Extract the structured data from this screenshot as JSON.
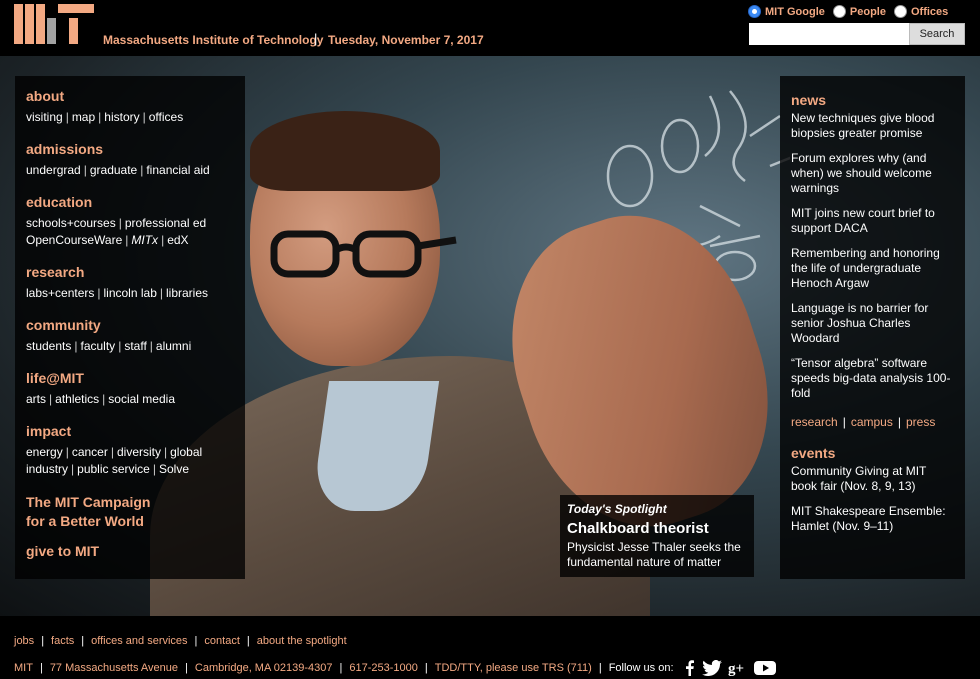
{
  "header": {
    "site_title": "Massachusetts Institute of Technology",
    "separator": "|",
    "date": "Tuesday, November 7, 2017",
    "search": {
      "options": [
        "MIT Google",
        "People",
        "Offices"
      ],
      "selected": "MIT Google",
      "button": "Search",
      "value": ""
    }
  },
  "leftnav": {
    "groups": [
      {
        "heading": "about",
        "lines": [
          [
            "visiting",
            "map",
            "history",
            "offices"
          ]
        ]
      },
      {
        "heading": "admissions",
        "lines": [
          [
            "undergrad",
            "graduate",
            "financial aid"
          ]
        ]
      },
      {
        "heading": "education",
        "lines": [
          [
            "schools+courses",
            "professional ed"
          ],
          [
            "OpenCourseWare",
            "MITx",
            "edX"
          ]
        ]
      },
      {
        "heading": "research",
        "lines": [
          [
            "labs+centers",
            "lincoln lab",
            "libraries"
          ]
        ]
      },
      {
        "heading": "community",
        "lines": [
          [
            "students",
            "faculty",
            "staff",
            "alumni"
          ]
        ]
      },
      {
        "heading": "life@MIT",
        "lines": [
          [
            "arts",
            "athletics",
            "social media"
          ]
        ]
      },
      {
        "heading": "impact",
        "lines": [
          [
            "energy",
            "cancer",
            "diversity",
            "global"
          ],
          [
            "industry",
            "public service",
            "Solve"
          ]
        ]
      }
    ],
    "campaign_line1": "The MIT Campaign",
    "campaign_line2": "for a Better World",
    "give": "give to MIT"
  },
  "spotlight": {
    "label": "Today's Spotlight",
    "title": "Chalkboard theorist",
    "description": "Physicist Jesse Thaler seeks the fundamental nature of matter"
  },
  "news": {
    "heading": "news",
    "items": [
      "New techniques give blood biopsies greater promise",
      "Forum explores why (and when) we should welcome warnings",
      "MIT joins new court brief to support DACA",
      "Remembering and honoring the life of undergraduate Henoch Argaw",
      "Language is no barrier for senior Joshua Charles Woodard",
      "“Tensor algebra” software speeds big-data analysis 100-fold"
    ],
    "links": [
      "research",
      "campus",
      "press"
    ]
  },
  "events": {
    "heading": "events",
    "items": [
      "Community Giving at MIT book fair (Nov. 8, 9, 13)",
      "MIT Shakespeare Ensemble: Hamlet (Nov. 9–11)"
    ]
  },
  "footer": {
    "row1": [
      "jobs",
      "facts",
      "offices and services",
      "contact",
      "about the spotlight"
    ],
    "row2": [
      "MIT",
      "77 Massachusetts Avenue",
      "Cambridge, MA 02139-4307",
      "617-253-1000",
      "TDD/TTY, please use TRS (711)"
    ],
    "follow": "Follow us on:",
    "social": [
      "facebook-icon",
      "twitter-icon",
      "google-plus-icon",
      "youtube-icon"
    ]
  },
  "colors": {
    "accent": "#f3a983",
    "background": "#000000"
  }
}
